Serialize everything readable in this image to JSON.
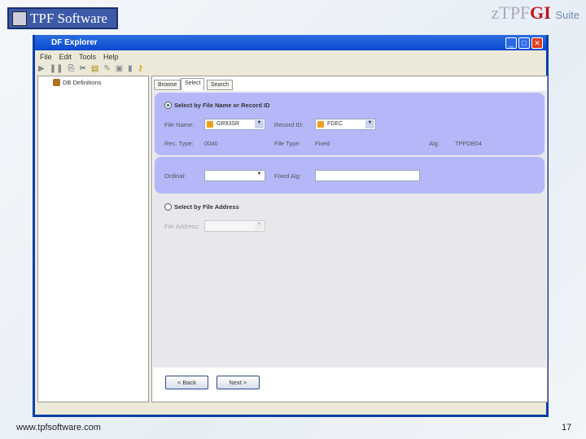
{
  "brand": {
    "logo_text": "TPF Software",
    "suite_prefix": "zTPF",
    "suite_gi": "GI",
    "suite_word": "Suite"
  },
  "window": {
    "title": "DF Explorer",
    "menu": [
      "File",
      "Edit",
      "Tools",
      "Help"
    ]
  },
  "tree": {
    "root": "DB Definitions"
  },
  "tabs": [
    "Browse",
    "Select",
    "Search"
  ],
  "select": {
    "option1": "Select by File Name or Record ID",
    "file_name_label": "File Name:",
    "file_name_value": "GR93SR",
    "record_id_label": "Record ID:",
    "record_id_value": "FDEC",
    "rec_type_label": "Rec. Type:",
    "rec_type_value": "0040",
    "file_type_label": "File Type:",
    "file_type_value": "Fixed",
    "alg_label": "Alg:",
    "alg_value": "TPFDB04",
    "ordinal_label": "Ordinal:",
    "ordinal_value": "",
    "fixed_alg_label": "Fixed Alg:",
    "fixed_alg_value": "",
    "option2": "Select by File Address",
    "file_address_label": "File Address:"
  },
  "buttons": {
    "back": "< Back",
    "next": "Next >"
  },
  "footer": {
    "url": "www.tpfsoftware.com",
    "page": "17"
  }
}
